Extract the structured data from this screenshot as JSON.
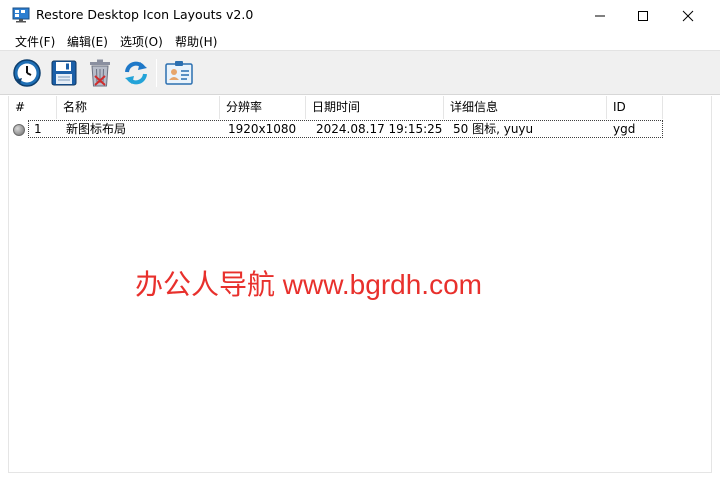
{
  "window": {
    "title": "Restore Desktop Icon Layouts v2.0",
    "app_icon": "desktop-icon"
  },
  "menu": [
    {
      "label": "文件(F)"
    },
    {
      "label": "编辑(E)"
    },
    {
      "label": "选项(O)"
    },
    {
      "label": "帮助(H)"
    }
  ],
  "toolbar": {
    "buttons": [
      {
        "icon": "restore-clock-icon"
      },
      {
        "icon": "save-floppy-icon"
      },
      {
        "icon": "delete-trash-icon"
      },
      {
        "icon": "refresh-icon"
      },
      {
        "icon": "id-card-icon"
      }
    ]
  },
  "table": {
    "columns": [
      "#",
      "名称",
      "分辨率",
      "日期时间",
      "详细信息",
      "ID"
    ],
    "rows": [
      {
        "num": "1",
        "name": "新图标布局",
        "resolution": "1920x1080",
        "datetime": "2024.08.17 19:15:25",
        "details": "50 图标, yuyu",
        "id": "ygd"
      }
    ]
  },
  "watermark": {
    "text": "办公人导航 www.bgrdh.com",
    "color": "#e8302c"
  },
  "colors": {
    "toolbar_bg": "#f0f0f0",
    "icon_blue": "#1f6fb5"
  }
}
